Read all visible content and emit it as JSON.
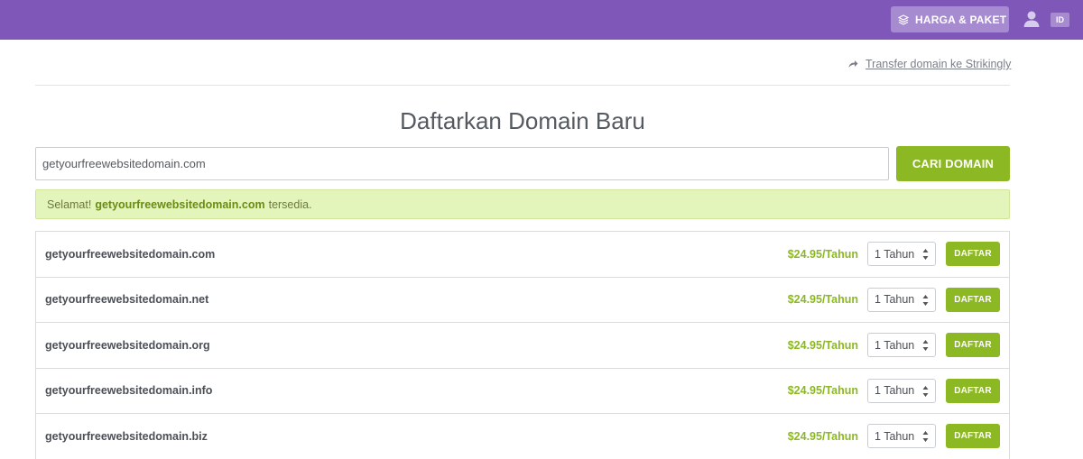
{
  "header": {
    "pricing_label": "HARGA & PAKET",
    "language": "ID",
    "accent_color": "#7e57b8"
  },
  "transfer_link": "Transfer domain ke Strikingly",
  "page_title": "Daftarkan Domain Baru",
  "search": {
    "value": "getyourfreewebsitedomain.com",
    "button_label": "CARI DOMAIN"
  },
  "success": {
    "prefix": "Selamat!",
    "domain": "getyourfreewebsitedomain.com",
    "suffix": "tersedia."
  },
  "results": [
    {
      "domain": "getyourfreewebsitedomain.com",
      "price": "$24.95/Tahun",
      "term": "1 Tahun",
      "button": "DAFTAR"
    },
    {
      "domain": "getyourfreewebsitedomain.net",
      "price": "$24.95/Tahun",
      "term": "1 Tahun",
      "button": "DAFTAR"
    },
    {
      "domain": "getyourfreewebsitedomain.org",
      "price": "$24.95/Tahun",
      "term": "1 Tahun",
      "button": "DAFTAR"
    },
    {
      "domain": "getyourfreewebsitedomain.info",
      "price": "$24.95/Tahun",
      "term": "1 Tahun",
      "button": "DAFTAR"
    },
    {
      "domain": "getyourfreewebsitedomain.biz",
      "price": "$24.95/Tahun",
      "term": "1 Tahun",
      "button": "DAFTAR"
    }
  ],
  "colors": {
    "brand_purple": "#7e57b8",
    "action_green": "#8cb823",
    "success_bg": "#e4f5bb"
  }
}
